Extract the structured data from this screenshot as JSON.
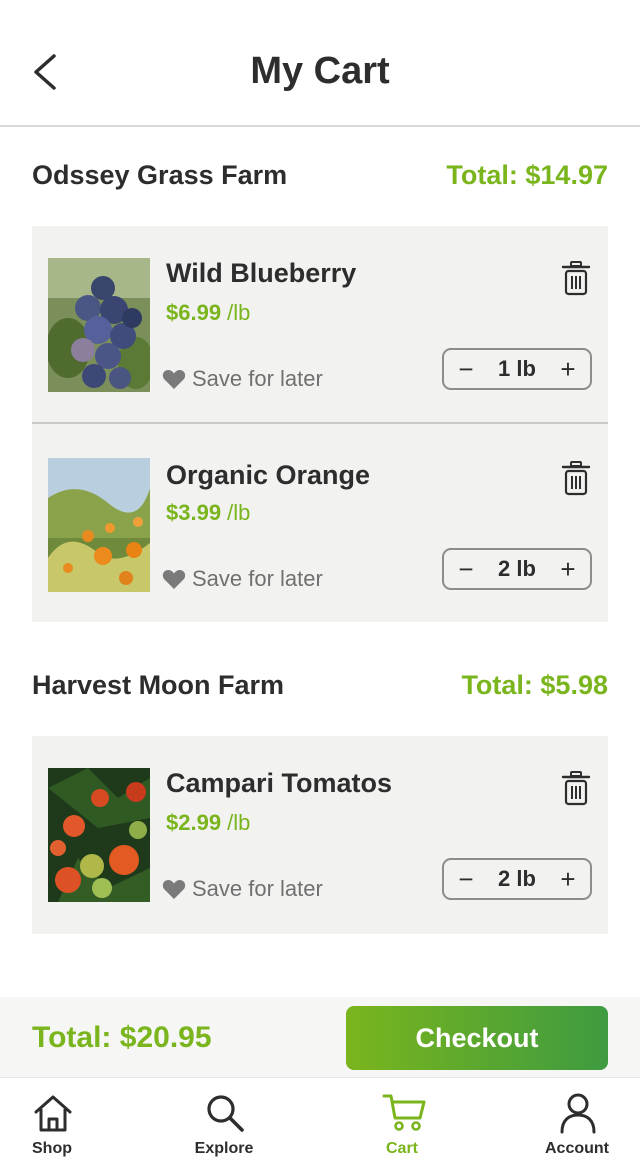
{
  "header": {
    "title": "My Cart"
  },
  "farms": [
    {
      "name": "Odssey Grass Farm",
      "total": "Total: $14.97",
      "items": [
        {
          "name": "Wild Blueberry",
          "price": "$6.99",
          "unit": " /lb",
          "save_label": "Save for later",
          "qty": "1 lb"
        },
        {
          "name": "Organic Orange",
          "price": "$3.99",
          "unit": " /lb",
          "save_label": "Save for later",
          "qty": "2 lb"
        }
      ]
    },
    {
      "name": "Harvest Moon Farm",
      "total": "Total: $5.98",
      "items": [
        {
          "name": "Campari Tomatos",
          "price": "$2.99",
          "unit": " /lb",
          "save_label": "Save for later",
          "qty": "2 lb"
        }
      ]
    }
  ],
  "summary": {
    "total": "Total: $20.95",
    "checkout_label": "Checkout"
  },
  "tabs": [
    {
      "label": "Shop",
      "icon": "home-icon"
    },
    {
      "label": "Explore",
      "icon": "search-icon"
    },
    {
      "label": "Cart",
      "icon": "cart-icon",
      "active": true
    },
    {
      "label": "Account",
      "icon": "user-icon"
    }
  ],
  "colors": {
    "accent": "#7ab51d",
    "accent_dark": "#3e9b40",
    "text": "#2d2d2d",
    "muted": "#707070",
    "card": "#f2f2f0"
  }
}
